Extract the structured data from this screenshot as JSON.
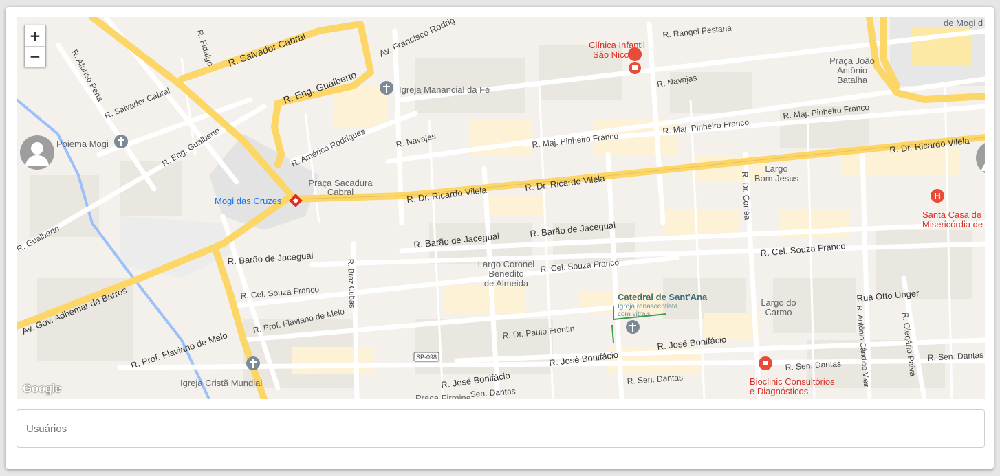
{
  "map": {
    "zoom_in": "+",
    "zoom_out": "−",
    "attribution": "Google",
    "streets": {
      "salvador_cabral_main": "R. Salvador Cabral",
      "salvador_cabral_small": "R. Salvador Cabral",
      "fidalgo": "R. Fidalgo",
      "francisco_rodrigues": "Av. Francisco Rodrig",
      "eng_gualberto_main": "R. Eng. Gualberto",
      "eng_gualberto_small": "R. Eng. Gualberto",
      "gualberto_left": "R. Gualberto",
      "afonso_pena": "R. Afonso Pena",
      "americo_rodrigues": "R. Américo Rodrigues",
      "navajas_left": "R. Navajas",
      "navajas_right": "R. Navajas",
      "rangel_pestana": "R. Rangel Pestana",
      "pinheiro_franco_1": "R. Maj. Pinheiro Franco",
      "pinheiro_franco_2": "R. Maj. Pinheiro Franco",
      "pinheiro_franco_3": "R. Maj. Pinheiro Franco",
      "ricardo_vilela_1": "R. Dr. Ricardo Vilela",
      "ricardo_vilela_2": "R. Dr. Ricardo Vilela",
      "ricardo_vilela_3": "R. Dr. Ricardo Vilela",
      "dr_correa": "R. Dr. Corrêa",
      "barao_jaceguai_1": "R. Barão de Jaceguai",
      "barao_jaceguai_2": "R. Barão de Jaceguai",
      "barao_jaceguai_3": "R. Barão de Jaceguai",
      "souza_franco_1": "R. Cel. Souza Franco",
      "souza_franco_2": "R. Cel. Souza Franco",
      "souza_franco_3": "R. Cel. Souza Franco",
      "adhemar_barros": "Av. Gov. Adhemar de Barros",
      "braz_cubas": "R. Braz Cubas",
      "flaviano_melo_1": "R. Prof. Flaviano de Melo",
      "flaviano_melo_2": "R. Prof. Flaviano de Melo",
      "paulo_frontin": "R. Dr. Paulo Frontin",
      "jose_bonifacio_1": "R. José Bonifácio",
      "jose_bonifacio_2": "R. José Bonifácio",
      "jose_bonifacio_3": "R. José Bonifácio",
      "sen_dantas_1": "R. Sen. Dantas",
      "sen_dantas_2": "R. Sen. Dantas",
      "sen_dantas_3": "R. Sen. Dantas",
      "sen_dantas_4": "Sen. Dantas",
      "otto_unger": "Rua Otto Unger",
      "olegario_paiva": "R. Olegário Paiva",
      "antonio_candido": "R. Antônio Cândido Vieir",
      "sp098": "SP-098"
    },
    "places": {
      "clinica_l1": "Clínica Infantil",
      "clinica_l2": "São Nicolau",
      "igreja_manancial": "Igreja Manancial da Fé",
      "poiema": "Poiema Mogi",
      "praca_joao_l1": "Praça João",
      "praca_joao_l2": "Antônio",
      "praca_joao_l3": "Batalha",
      "mogi_corner": "de Mogi d",
      "praca_sacadura_l1": "Praça Sacadura",
      "praca_sacadura_l2": "Cabral",
      "mogi_das_cruzes": "Mogi das Cruzes",
      "largo_bom_jesus_l1": "Largo",
      "largo_bom_jesus_l2": "Bom Jesus",
      "santa_casa_l1": "Santa Casa de",
      "santa_casa_l2": "Misericórdia de",
      "largo_coronel_l1": "Largo Coronel",
      "largo_coronel_l2": "Benedito",
      "largo_coronel_l3": "de Almeida",
      "catedral": "Catedral de Sant'Ana",
      "catedral_sub_l1": "Igreja renascentista",
      "catedral_sub_l2": "com vitrais",
      "largo_carmo_l1": "Largo do",
      "largo_carmo_l2": "Carmo",
      "igreja_crista": "Igreja Cristã Mundial",
      "bioclinic_l1": "Bioclinic Consultórios",
      "bioclinic_l2": "e Diagnósticos",
      "praca_firmina": "Praça Firmina"
    }
  },
  "users_field": {
    "label": "Usuários"
  },
  "colors": {
    "major_road": "#fcd667",
    "minor_road": "#ffffff",
    "river": "#9cc0f9",
    "poi_red": "#e84b37",
    "poi_gray": "#7b8a96",
    "label_blue": "#1a73e8"
  }
}
